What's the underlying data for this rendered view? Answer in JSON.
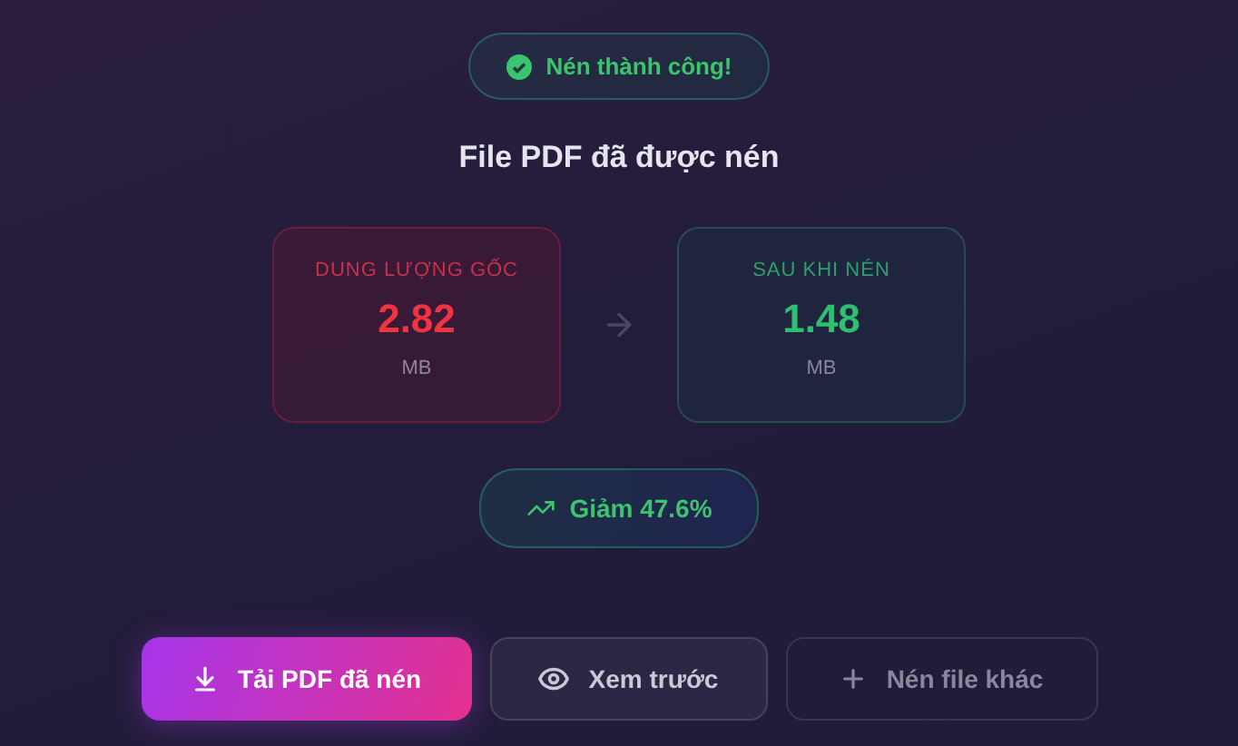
{
  "status": {
    "label": "Nén thành công!"
  },
  "title": "File PDF đã được nén",
  "sizes": [
    {
      "kind": "original",
      "label": "DUNG LƯỢNG GỐC",
      "value": "2.82",
      "unit": "MB"
    },
    {
      "kind": "compressed",
      "label": "SAU KHI NÉN",
      "value": "1.48",
      "unit": "MB"
    }
  ],
  "reduction": {
    "label": "Giảm 47.6%"
  },
  "buttons": [
    {
      "kind": "primary",
      "label": "Tải PDF đã nén"
    },
    {
      "kind": "secondary",
      "label": "Xem trước"
    },
    {
      "kind": "ghost",
      "label": "Nén file khác"
    }
  ]
}
